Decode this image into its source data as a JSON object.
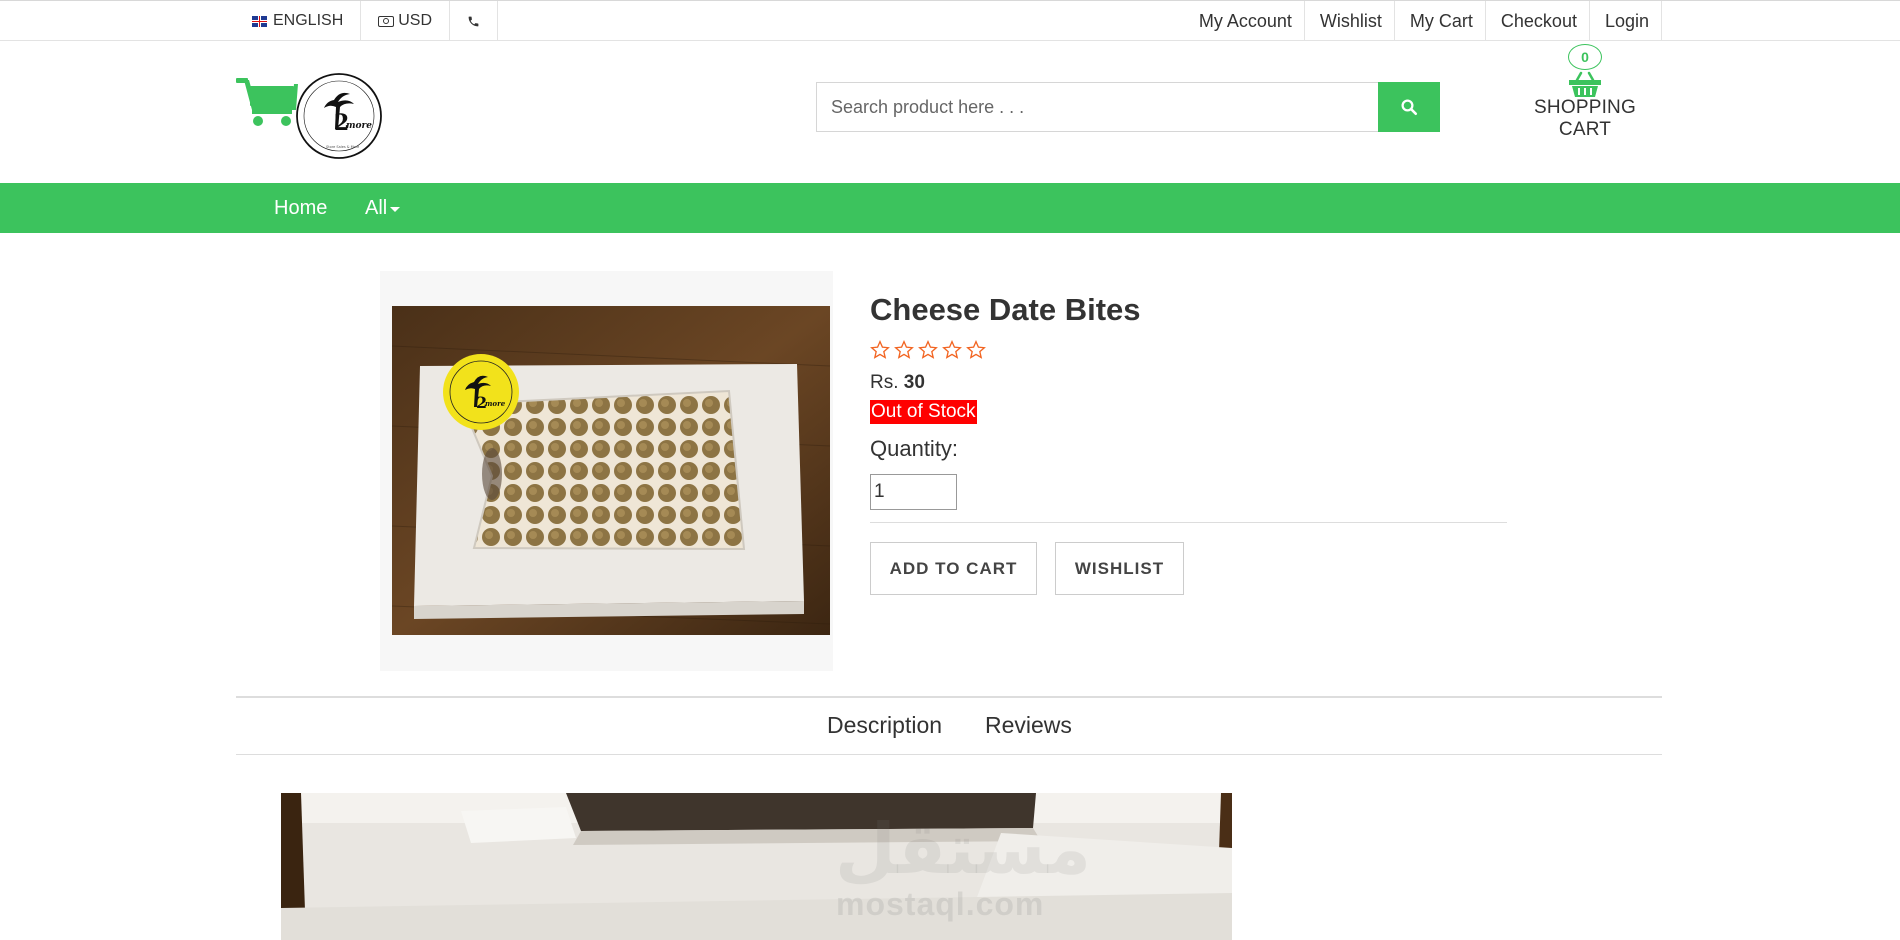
{
  "topbar": {
    "language": "ENGLISH",
    "currency": "USD",
    "links": [
      "My Account",
      "Wishlist",
      "My Cart",
      "Checkout",
      "Login"
    ]
  },
  "header": {
    "logo_text": "2 more",
    "search_placeholder": "Search product here . . .",
    "cart_count": "0",
    "cart_label": "SHOPPING CART"
  },
  "nav": {
    "home": "Home",
    "all": "All"
  },
  "product": {
    "name": "Cheese Date Bites",
    "rating": 0,
    "rating_max": 5,
    "price_prefix": "Rs.",
    "price": "30",
    "stock_status": "Out of Stock",
    "quantity_label": "Quantity:",
    "quantity_value": "1",
    "add_to_cart": "ADD TO CART",
    "wishlist": "WISHLIST"
  },
  "tabs": {
    "description": "Description",
    "reviews": "Reviews"
  },
  "watermark": {
    "arabic": "مستقل",
    "latin": "mostaql.com"
  },
  "colors": {
    "brand_green": "#3cc35d",
    "star_orange": "#f26522",
    "stock_red": "#ff0000"
  }
}
